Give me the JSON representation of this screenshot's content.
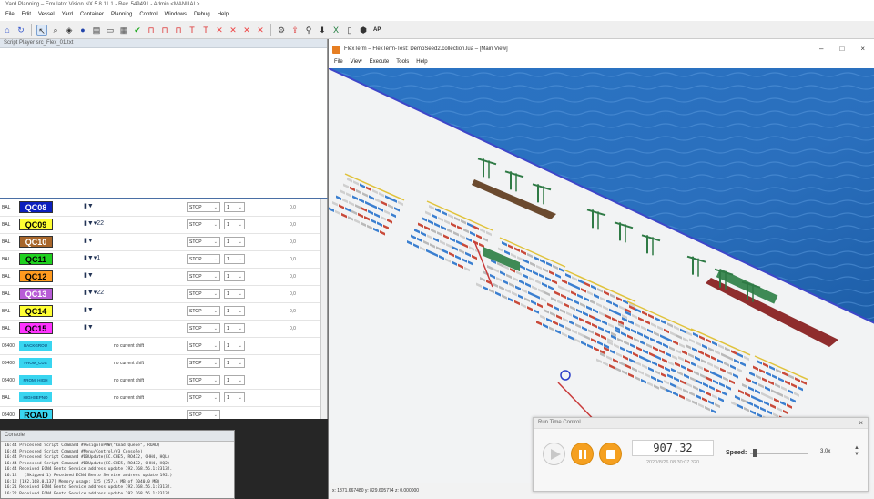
{
  "app": {
    "title": "Yard Planning – Emulator Vision NX 5.8.11.1 - Rev. 549491 - Admin <MANUAL>",
    "menu": [
      "File",
      "Edit",
      "Vessel",
      "Yard",
      "Container",
      "Planning",
      "Control",
      "Windows",
      "Debug",
      "Help"
    ],
    "toolbar_end_label": "AP",
    "script_panel_title": "Script Player src_Flex_01.txt"
  },
  "grid": {
    "rows": [
      {
        "prefix": "BAL",
        "label": "QC08",
        "color": "#0c1fbd",
        "text_color": "#ffffff",
        "icons": "▮▼",
        "state": "STOP",
        "lane": "1",
        "value": "0,0"
      },
      {
        "prefix": "BAL",
        "label": "QC09",
        "color": "#ffff33",
        "text_color": "#000000",
        "icons": "▮▼▾22",
        "state": "STOP",
        "lane": "1",
        "value": "0,0"
      },
      {
        "prefix": "BAL",
        "label": "QC10",
        "color": "#a8662a",
        "text_color": "#ffffff",
        "icons": "▮▼",
        "state": "STOP",
        "lane": "1",
        "value": "0,0"
      },
      {
        "prefix": "BAL",
        "label": "QC11",
        "color": "#1fd11f",
        "text_color": "#000000",
        "icons": "▮▼▾1",
        "state": "STOP",
        "lane": "1",
        "value": "0,0"
      },
      {
        "prefix": "BAL",
        "label": "QC12",
        "color": "#ff9a1f",
        "text_color": "#000000",
        "icons": "▮▼",
        "state": "STOP",
        "lane": "1",
        "value": "0,0"
      },
      {
        "prefix": "BAL",
        "label": "QC13",
        "color": "#b85cd6",
        "text_color": "#ffffff",
        "icons": "▮▼▾22",
        "state": "STOP",
        "lane": "1",
        "value": "0,0"
      },
      {
        "prefix": "BAL",
        "label": "QC14",
        "color": "#ffff33",
        "text_color": "#000000",
        "icons": "▮▼",
        "state": "STOP",
        "lane": "1",
        "value": "0,0"
      },
      {
        "prefix": "BAL",
        "label": "QC15",
        "color": "#ff33ff",
        "text_color": "#000000",
        "icons": "▮▼",
        "state": "STOP",
        "lane": "1",
        "value": "0,0"
      }
    ],
    "ext_rows": [
      {
        "prefix": "03400",
        "label": "BACKGROU",
        "shift": "no current shift",
        "state": "STOP",
        "lane": "1"
      },
      {
        "prefix": "03400",
        "label": "FROM_CUS",
        "shift": "no current shift",
        "state": "STOP",
        "lane": "1"
      },
      {
        "prefix": "03400",
        "label": "FROM_HIGH",
        "shift": "no current shift",
        "state": "STOP",
        "lane": "1"
      },
      {
        "prefix": "BAL",
        "label": "HIGHSEPNO",
        "shift": "no current shift",
        "state": "STOP",
        "lane": "1"
      }
    ],
    "road_row": {
      "prefix": "03400",
      "label": "ROAD",
      "state": "STOP"
    }
  },
  "console": {
    "title": "Console",
    "lines": [
      "16:44 Processed Script Command #ASsignToPOW(\"Road Queue\", ROAD)",
      "16:44 Processed Script Command #Menu/Control/#3 Console)",
      "16:44 Processed Script Command #DBUpdate(EC.CHE5, RO432, CHH4, HQL)",
      "16:44 Processed Script Command #DBUpdate(EC.CHE5, RO432, CHH4, HQ2)",
      "16:44 Received ECN4 Bento Service address update 192.168.56.1:23132.",
      "16:12   (Skipped 1) Received ECN4 Bento Service address update 192.)",
      "16:12 [192.168.0.137] Memory usage: 125 (257.4 MB of 1040.0 MB)",
      "16:21 Received ECN4 Bento Service address update 192.168.56.1:23132.",
      "16:22 Received ECN4 Bento Service address update 192.168.56.1:23132."
    ]
  },
  "flexterm": {
    "title": "FlexTerm – FlexTerm-Test: DemoSeed2.collection.lua – [Main View]",
    "menu": [
      "File",
      "View",
      "Execute",
      "Tools",
      "Help"
    ],
    "window_controls": [
      "–",
      "□",
      "×"
    ],
    "status": "x: 1871.667480 y: 829.605774 z: 0.000000"
  },
  "runtime": {
    "title": "Run Time Control",
    "close": "×",
    "clock": "907.32",
    "datetime": "2020/8/26 08:30:07.320",
    "speed_label": "Speed:",
    "speed_value": "3.0x",
    "speed_fraction": 0.08
  }
}
